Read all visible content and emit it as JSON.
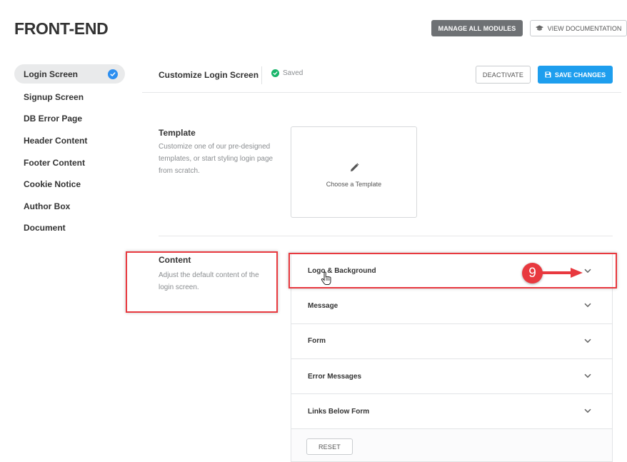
{
  "header": {
    "title": "FRONT-END",
    "manage_label": "MANAGE ALL MODULES",
    "docs_label": "VIEW DOCUMENTATION"
  },
  "sidebar": {
    "items": [
      {
        "label": "Login Screen",
        "active": true
      },
      {
        "label": "Signup Screen"
      },
      {
        "label": "DB Error Page"
      },
      {
        "label": "Header Content"
      },
      {
        "label": "Footer Content"
      },
      {
        "label": "Cookie Notice"
      },
      {
        "label": "Author Box"
      },
      {
        "label": "Document"
      }
    ]
  },
  "toolbar": {
    "title": "Customize Login Screen",
    "status": "Saved",
    "deactivate_label": "DEACTIVATE",
    "save_label": "SAVE CHANGES"
  },
  "template_section": {
    "title": "Template",
    "description": "Customize one of our pre-designed templates, or start styling login page from scratch.",
    "choose_label": "Choose a Template"
  },
  "content_section": {
    "title": "Content",
    "description": "Adjust the default content of the login screen.",
    "items": [
      {
        "label": "Logo & Background"
      },
      {
        "label": "Message"
      },
      {
        "label": "Form"
      },
      {
        "label": "Error Messages"
      },
      {
        "label": "Links Below Form"
      }
    ],
    "reset_label": "RESET"
  },
  "annotation": {
    "step_number": "9",
    "color": "#e8393f"
  },
  "colors": {
    "primary": "#1e9eee",
    "saved_green": "#19b56a",
    "manage_gray": "#6e7174"
  }
}
